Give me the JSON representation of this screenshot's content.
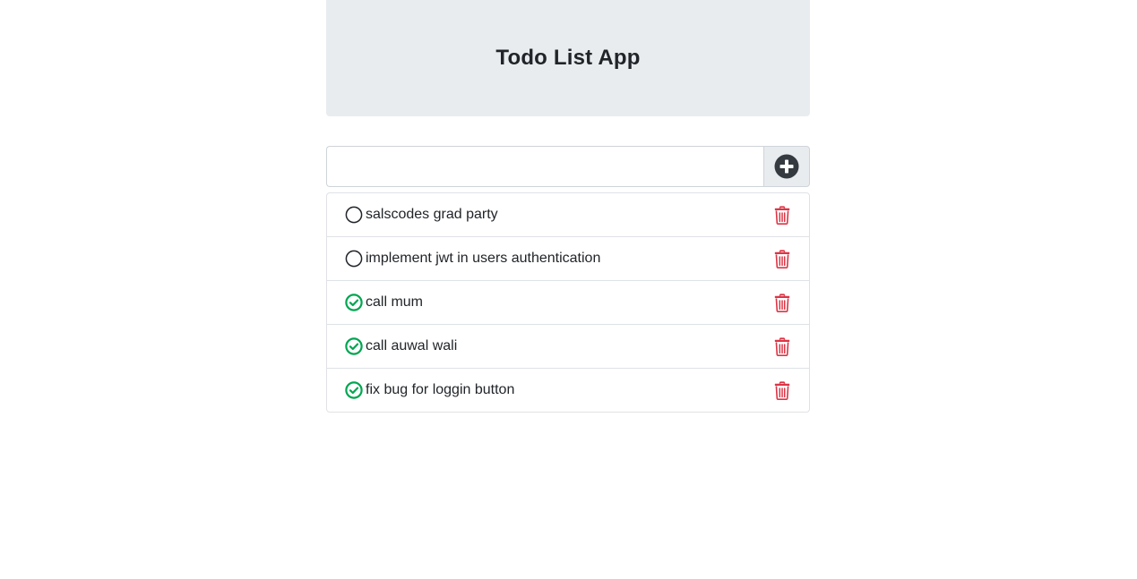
{
  "header": {
    "title": "Todo List App"
  },
  "new_todo": {
    "value": "",
    "placeholder": ""
  },
  "colors": {
    "done": "#00a651",
    "delete": "#dc3545",
    "add_icon": "#343a40"
  },
  "todos": [
    {
      "text": "salscodes grad party",
      "done": false
    },
    {
      "text": "implement jwt in users authentication",
      "done": false
    },
    {
      "text": "call mum",
      "done": true
    },
    {
      "text": "call auwal wali",
      "done": true
    },
    {
      "text": "fix bug for loggin button",
      "done": true
    }
  ]
}
